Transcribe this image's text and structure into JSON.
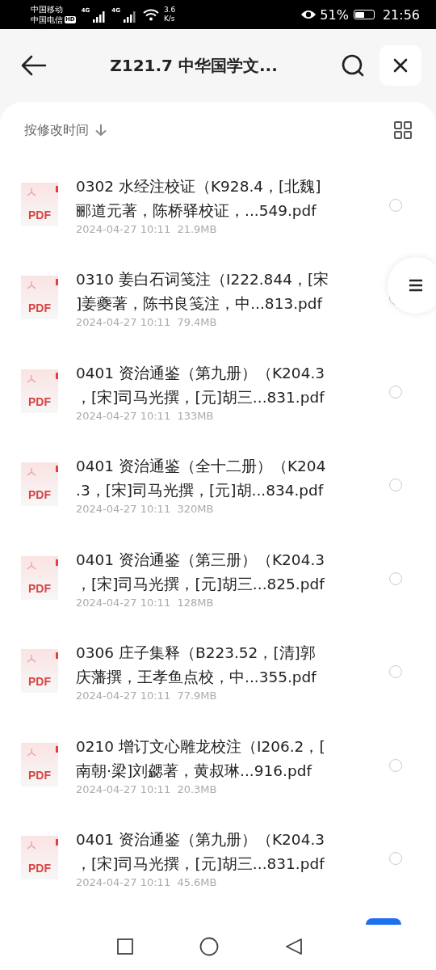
{
  "status_bar": {
    "carrier_1": "中国移动",
    "carrier_2": "中国电信",
    "hd_badge": "HD",
    "network_1": "4G",
    "network_2": "4G",
    "speed_value": "3.6",
    "speed_unit": "K/s",
    "battery_percent": "51%",
    "time": "21:56"
  },
  "header": {
    "title": "Z121.7 中华国学文..."
  },
  "sort": {
    "label": "按修改时间"
  },
  "files": [
    {
      "name_line_1": "0302 水经注校证（K928.4，[北魏]",
      "name_line_2": "郦道元著，陈桥驿校证，...549.pdf",
      "badge": "PDF",
      "meta": "2024-04-27 10:11  21.9MB",
      "selected": false
    },
    {
      "name_line_1": "0310 姜白石词笺注（I222.844，[宋",
      "name_line_2": "]姜夔著，陈书良笺注，中...813.pdf",
      "badge": "PDF",
      "meta": "2024-04-27 10:11  79.4MB",
      "selected": false
    },
    {
      "name_line_1": "0401 资治通鉴（第九册）（K204.3",
      "name_line_2": "，[宋]司马光撰，[元]胡三...831.pdf",
      "badge": "PDF",
      "meta": "2024-04-27 10:11  133MB",
      "selected": false
    },
    {
      "name_line_1": "0401 资治通鉴（全十二册）（K204",
      "name_line_2": ".3，[宋]司马光撰，[元]胡...834.pdf",
      "badge": "PDF",
      "meta": "2024-04-27 10:11  320MB",
      "selected": false
    },
    {
      "name_line_1": "0401 资治通鉴（第三册）（K204.3",
      "name_line_2": "，[宋]司马光撰，[元]胡三...825.pdf",
      "badge": "PDF",
      "meta": "2024-04-27 10:11  128MB",
      "selected": false
    },
    {
      "name_line_1": "0306 庄子集释（B223.52，[清]郭",
      "name_line_2": "庆藩撰，王孝鱼点校，中...355.pdf",
      "badge": "PDF",
      "meta": "2024-04-27 10:11  77.9MB",
      "selected": false
    },
    {
      "name_line_1": "0210 增订文心雕龙校注（I206.2，[",
      "name_line_2": "南朝·梁]刘勰著，黄叔琳...916.pdf",
      "badge": "PDF",
      "meta": "2024-04-27 10:11  20.3MB",
      "selected": false
    },
    {
      "name_line_1": "0401 资治通鉴（第九册）（K204.3",
      "name_line_2": "，[宋]司马光撰，[元]胡三...831.pdf",
      "badge": "PDF",
      "meta": "2024-04-27 10:11  45.6MB",
      "selected": false
    }
  ]
}
